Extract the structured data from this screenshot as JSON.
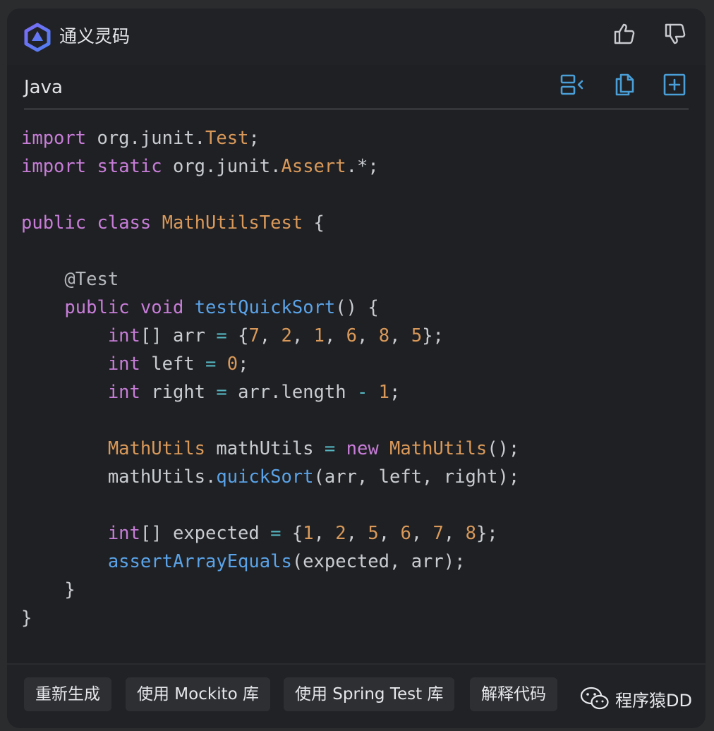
{
  "header": {
    "app_name": "通义灵码",
    "logo_icon": "tongyi-lingma-logo",
    "thumbs_up_icon": "thumbs-up-icon",
    "thumbs_down_icon": "thumbs-down-icon"
  },
  "code_block": {
    "language": "Java",
    "toolbar_icons": [
      "insert-at-cursor-icon",
      "copy-icon",
      "new-file-icon"
    ],
    "lines": [
      "import org.junit.Test;",
      "import static org.junit.Assert.*;",
      "",
      "public class MathUtilsTest {",
      "",
      "    @Test",
      "    public void testQuickSort() {",
      "        int[] arr = {7, 2, 1, 6, 8, 5};",
      "        int left = 0;",
      "        int right = arr.length - 1;",
      "",
      "        MathUtils mathUtils = new MathUtils();",
      "        mathUtils.quickSort(arr, left, right);",
      "",
      "        int[] expected = {1, 2, 5, 6, 7, 8};",
      "        assertArrayEquals(expected, arr);",
      "    }",
      "}"
    ]
  },
  "actions": [
    "重新生成",
    "使用 Mockito 库",
    "使用 Spring Test 库",
    "解释代码"
  ],
  "watermark": {
    "icon": "wechat-icon",
    "text": "程序猿DD"
  },
  "colors": {
    "keyword": "#c77dd8",
    "type": "#d9995a",
    "number": "#d9995a",
    "function": "#5aa3e8",
    "operator": "#56b6c2",
    "toolbar_accent": "#4a9fd8"
  }
}
